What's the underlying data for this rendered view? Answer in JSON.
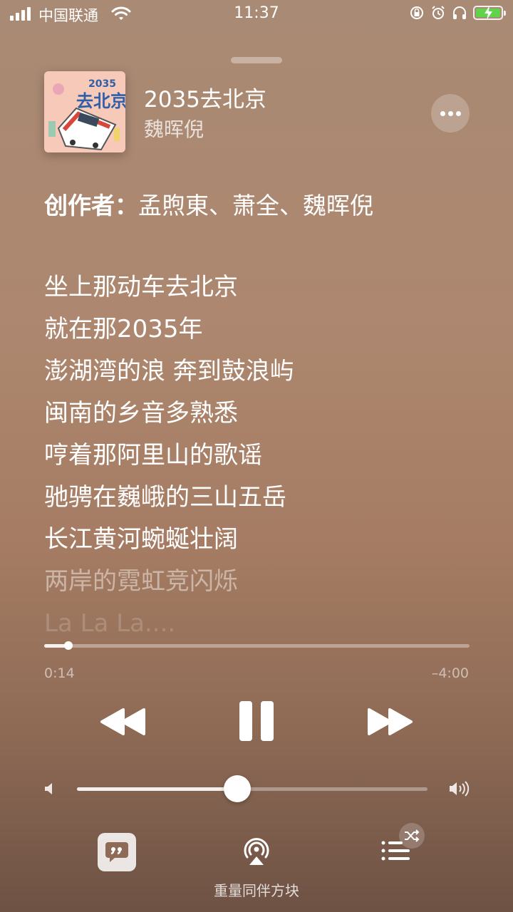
{
  "status_bar": {
    "carrier": "中国联通",
    "time": "11:37"
  },
  "now_playing": {
    "title": "2035去北京",
    "artist": "魏晖倪",
    "credits_label": "创作者：",
    "credits_names": "孟煦東、萧全、魏晖倪"
  },
  "lyrics": [
    "坐上那动车去北京",
    "就在那2035年",
    "澎湖湾的浪 奔到鼓浪屿",
    "闽南的乡音多熟悉",
    "哼着那阿里山的歌谣",
    "驰骋在巍峨的三山五岳",
    "长江黄河蜿蜒壮阔",
    "两岸的霓虹竞闪烁",
    "La La La...."
  ],
  "playback": {
    "elapsed": "0:14",
    "remaining": "–4:00",
    "progress_fraction": 0.057
  },
  "volume": {
    "level_fraction": 0.46
  },
  "bottom_bar": {
    "airplay_device": "重量同伴方块"
  },
  "colors": {
    "background_top": "#a98a74",
    "background_bottom": "#6e5244",
    "battery_fill": "#5fd34a"
  }
}
